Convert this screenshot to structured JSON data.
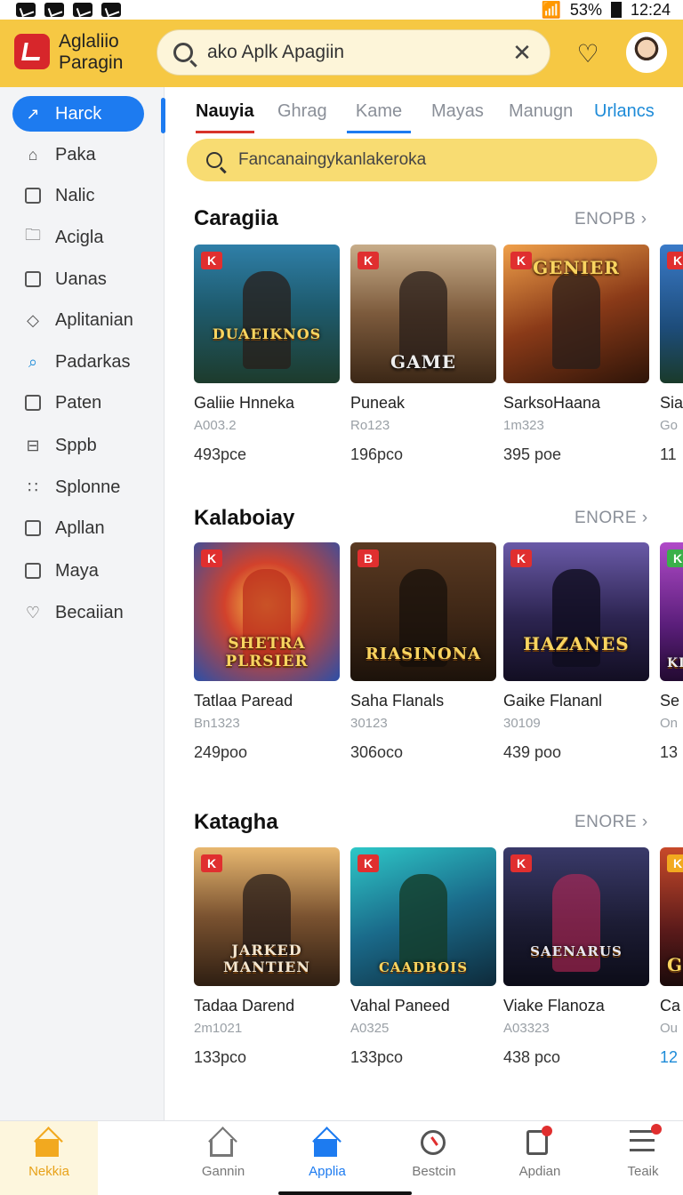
{
  "status": {
    "battery": "53%",
    "time": "12:24"
  },
  "header": {
    "brand_line1": "Aglaliio",
    "brand_line2": "Paragin",
    "search_value": "ako Aplk Apagiin",
    "clear_icon": "close-icon",
    "brand_color": "#f6c843"
  },
  "sidebar": {
    "items": [
      {
        "label": "Harck",
        "icon": "trend-icon"
      },
      {
        "label": "Paka",
        "icon": "home-icon"
      },
      {
        "label": "Nalic",
        "icon": "music-icon"
      },
      {
        "label": "Acigla",
        "icon": "folder-icon"
      },
      {
        "label": "Uanas",
        "icon": "square-icon"
      },
      {
        "label": "Aplitanian",
        "icon": "diamond-icon"
      },
      {
        "label": "Padarkas",
        "icon": "search-icon"
      },
      {
        "label": "Paten",
        "icon": "square-icon"
      },
      {
        "label": "Sppb",
        "icon": "minus-square-icon"
      },
      {
        "label": "Splonne",
        "icon": "dots-icon"
      },
      {
        "label": "Apllan",
        "icon": "chart-icon"
      },
      {
        "label": "Maya",
        "icon": "image-icon"
      },
      {
        "label": "Becaiian",
        "icon": "heart-icon"
      }
    ],
    "accent": "#1d7bf0"
  },
  "tabs": [
    {
      "label": "Nauyia"
    },
    {
      "label": "Ghrag"
    },
    {
      "label": "Kame"
    },
    {
      "label": "Mayas"
    },
    {
      "label": "Manugn"
    },
    {
      "label": "Urlancs"
    }
  ],
  "filter": {
    "text": "Fancanaingykanlakeroka"
  },
  "sections": [
    {
      "title": "Caragiia",
      "more": "ENOPB",
      "cards": [
        {
          "name": "Galiie Hnneka",
          "sub": "A003.2",
          "price": "493pce",
          "art": "DUAEIKNOS",
          "badge": "K"
        },
        {
          "name": "Puneak",
          "sub": "Ro123",
          "price": "196pco",
          "art": "GAME",
          "badge": "K"
        },
        {
          "name": "SarksoHaana",
          "sub": "1m323",
          "price": "395 poe",
          "art": "GENIER",
          "badge": "K"
        },
        {
          "name": "Sia",
          "sub": "Go",
          "price": "11",
          "art": "",
          "badge": "K"
        }
      ]
    },
    {
      "title": "Kalaboiay",
      "more": "ENORE",
      "cards": [
        {
          "name": "Tatlaa Paread",
          "sub": "Bn1323",
          "price": "249poo",
          "art": "SHETRA PLRSIER",
          "badge": "K"
        },
        {
          "name": "Saha Flanals",
          "sub": "30123",
          "price": "306oco",
          "art": "RIASINONA",
          "badge": "B"
        },
        {
          "name": "Gaike Flananl",
          "sub": "30109",
          "price": "439 poo",
          "art": "HAZANES",
          "badge": "K"
        },
        {
          "name": "Se",
          "sub": "On",
          "price": "13",
          "art": "KIV",
          "badge": "K"
        }
      ]
    },
    {
      "title": "Katagha",
      "more": "ENORE",
      "cards": [
        {
          "name": "Tadaa Darend",
          "sub": "2m1021",
          "price": "133pco",
          "art": "JARKED MANTIEN",
          "badge": "K"
        },
        {
          "name": "Vahal Paneed",
          "sub": "A0325",
          "price": "133pco",
          "art": "CAADBOIS",
          "badge": "K"
        },
        {
          "name": "Viake Flanoza",
          "sub": "A03323",
          "price": "438 pco",
          "art": "SAENARUS",
          "badge": "K"
        },
        {
          "name": "Ca",
          "sub": "Ou",
          "price": "12",
          "art": "G",
          "badge": "K"
        }
      ]
    }
  ],
  "bottom_nav": [
    {
      "label": "Nekkia",
      "icon": "home-icon"
    },
    {
      "label": "Gannin",
      "icon": "home-outline-icon"
    },
    {
      "label": "Applia",
      "icon": "home-icon"
    },
    {
      "label": "Bestcin",
      "icon": "gauge-icon"
    },
    {
      "label": "Apdian",
      "icon": "document-icon"
    },
    {
      "label": "Teaik",
      "icon": "list-icon"
    }
  ]
}
